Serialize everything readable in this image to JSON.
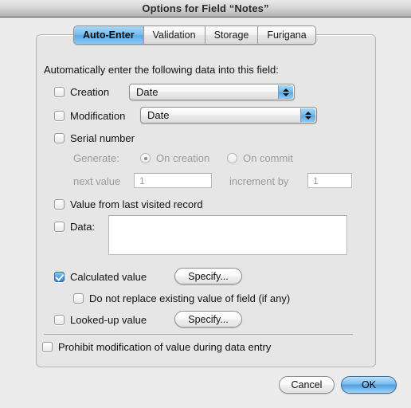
{
  "window": {
    "title": "Options for Field “Notes”"
  },
  "tabs": [
    {
      "label": "Auto-Enter",
      "active": true
    },
    {
      "label": "Validation",
      "active": false
    },
    {
      "label": "Storage",
      "active": false
    },
    {
      "label": "Furigana",
      "active": false
    }
  ],
  "panel": {
    "intro": "Automatically enter the following data into this field:",
    "creation": {
      "label": "Creation",
      "checked": false,
      "popup_value": "Date"
    },
    "modification": {
      "label": "Modification",
      "checked": false,
      "popup_value": "Date"
    },
    "serial_number": {
      "label": "Serial number",
      "checked": false,
      "generate_label": "Generate:",
      "on_creation_label": "On creation",
      "on_creation_selected": true,
      "on_commit_label": "On commit",
      "on_commit_selected": false,
      "next_value_label": "next value",
      "next_value": "1",
      "increment_by_label": "increment by",
      "increment_by": "1"
    },
    "value_from_last_visited": {
      "label": "Value from last visited record",
      "checked": false
    },
    "data": {
      "label": "Data:",
      "checked": false,
      "value": ""
    },
    "calculated_value": {
      "label": "Calculated value",
      "checked": true,
      "specify_label": "Specify..."
    },
    "do_not_replace": {
      "label": "Do not replace existing value of field (if any)",
      "checked": false
    },
    "looked_up_value": {
      "label": "Looked-up value",
      "checked": false,
      "specify_label": "Specify..."
    },
    "prohibit_modification": {
      "label": "Prohibit modification of value during data entry",
      "checked": false
    }
  },
  "footer": {
    "cancel_label": "Cancel",
    "ok_label": "OK"
  },
  "colors": {
    "accent_blue": "#4f9fe0",
    "window_bg": "#ececec",
    "group_bg": "#e6e6e6"
  }
}
